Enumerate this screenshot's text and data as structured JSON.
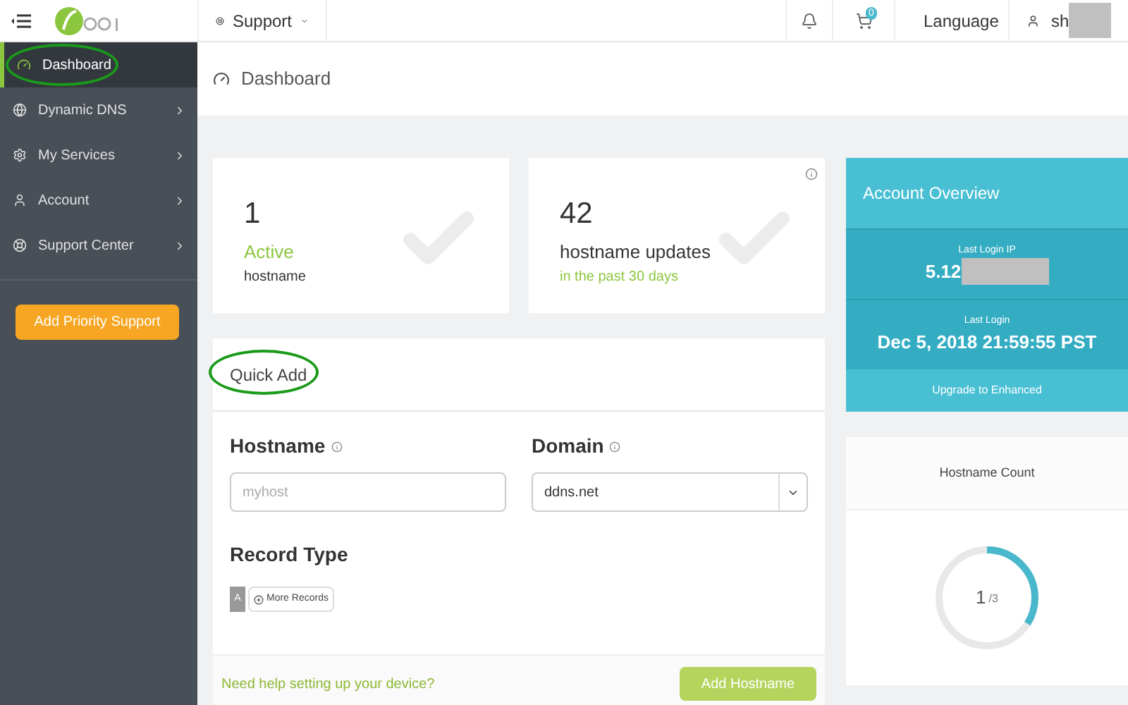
{
  "topbar": {
    "support_menu": "Support",
    "cart_count": "0",
    "language": "Language",
    "user": "sh"
  },
  "sidebar": {
    "items": [
      {
        "label": "Dashboard",
        "selected": true,
        "has_children": false
      },
      {
        "label": "Dynamic DNS",
        "selected": false,
        "has_children": true
      },
      {
        "label": "My Services",
        "selected": false,
        "has_children": true
      },
      {
        "label": "Account",
        "selected": false,
        "has_children": true
      },
      {
        "label": "Support Center",
        "selected": false,
        "has_children": true
      }
    ],
    "button": "Add Priority Support"
  },
  "page_title": "Dashboard",
  "stats": [
    {
      "value": "1",
      "highlight": "Active",
      "label": "hostname",
      "info": false
    },
    {
      "value": "42",
      "label": "hostname updates",
      "highlight": "in the past 30 days",
      "info": true
    }
  ],
  "quick_add": {
    "title": "Quick Add",
    "hostname_label": "Hostname",
    "hostname_placeholder": "myhost",
    "domain_label": "Domain",
    "domain_value": "ddns.net",
    "record_type_label": "Record Type",
    "record_type": "A",
    "more_records": "More Records",
    "help_link": "Need help setting up your device?",
    "submit": "Add Hostname"
  },
  "account_overview": {
    "title": "Account Overview",
    "last_login_ip_label": "Last Login IP",
    "last_login_ip": "5.12",
    "last_login_label": "Last Login",
    "last_login": "Dec 5, 2018 21:59:55 PST",
    "upgrade": "Upgrade to Enhanced"
  },
  "hostname_count": {
    "title": "Hostname Count",
    "used": "1",
    "total": "/3",
    "level": 0.34
  }
}
